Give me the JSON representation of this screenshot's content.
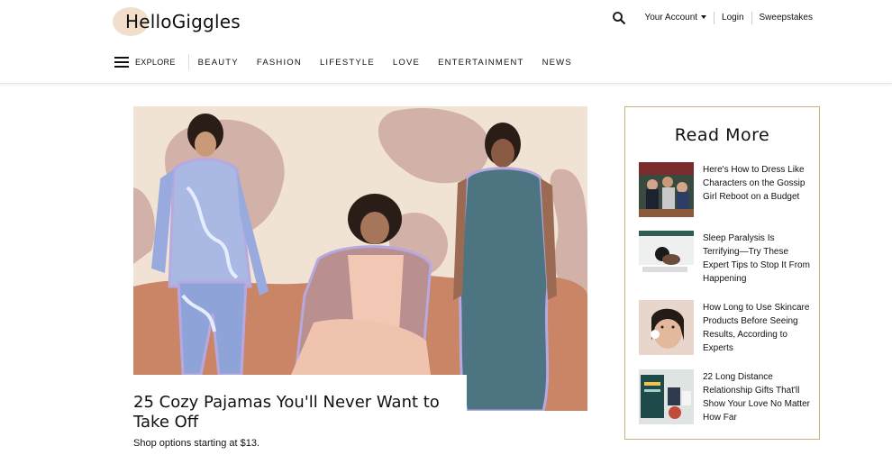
{
  "header": {
    "logo_text": "HelloGiggles",
    "account_label": "Your Account",
    "login_label": "Login",
    "sweepstakes_label": "Sweepstakes"
  },
  "nav": {
    "explore_label": "EXPLORE",
    "items": [
      "BEAUTY",
      "FASHION",
      "LIFESTYLE",
      "LOVE",
      "ENTERTAINMENT",
      "NEWS"
    ]
  },
  "hero": {
    "headline": "25 Cozy Pajamas You'll Never Want to Take Off",
    "subline": "Shop options starting at $13."
  },
  "sidebar": {
    "title": "Read More",
    "items": [
      {
        "title": "Here's How to Dress Like Characters on the Gossip Girl Reboot on a Budget"
      },
      {
        "title": "Sleep Paralysis Is Terrifying—Try These Expert Tips to Stop It From Happening"
      },
      {
        "title": "How Long to Use Skincare Products Before Seeing Results, According to Experts"
      },
      {
        "title": "22 Long Distance Relationship Gifts That'll Show Your Love No Matter How Far"
      }
    ]
  },
  "colors": {
    "accent_border": "#c9b27c",
    "hero_bg": "#f1e3d3",
    "blob_mauve": "#d2b1a8",
    "blob_terracotta": "#c98566"
  }
}
